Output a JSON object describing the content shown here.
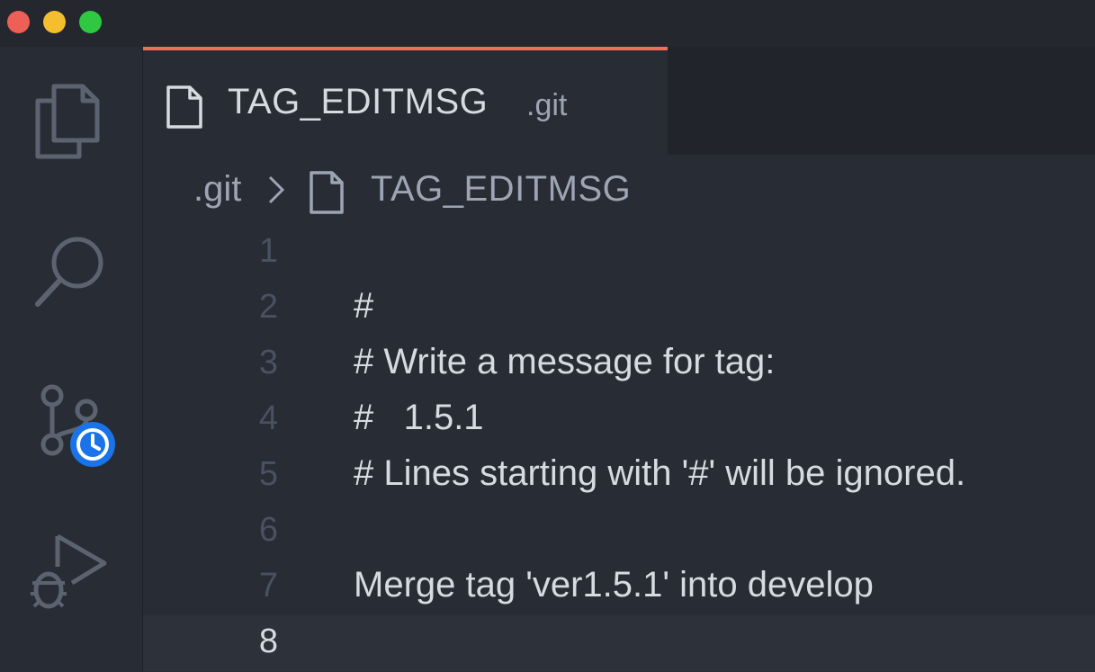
{
  "window": {
    "controls": [
      "close",
      "minimize",
      "maximize"
    ]
  },
  "activity_bar": {
    "items": [
      {
        "icon": "files-icon"
      },
      {
        "icon": "search-icon"
      },
      {
        "icon": "source-control-icon",
        "badge_icon": "clock-icon",
        "badge_color": "#1a73e8"
      },
      {
        "icon": "run-debug-icon"
      }
    ]
  },
  "tab": {
    "title": "TAG_EDITMSG",
    "description": ".git",
    "accent_color": "#f06e57"
  },
  "breadcrumb": {
    "folder": ".git",
    "file": "TAG_EDITMSG"
  },
  "editor": {
    "current_line": 8,
    "lines": [
      {
        "number": "1",
        "text": ""
      },
      {
        "number": "2",
        "text": "#"
      },
      {
        "number": "3",
        "text": "# Write a message for tag:"
      },
      {
        "number": "4",
        "text": "#   1.5.1"
      },
      {
        "number": "5",
        "text": "# Lines starting with '#' will be ignored."
      },
      {
        "number": "6",
        "text": ""
      },
      {
        "number": "7",
        "text": "Merge tag 'ver1.5.1' into develop"
      },
      {
        "number": "8",
        "text": ""
      }
    ]
  }
}
